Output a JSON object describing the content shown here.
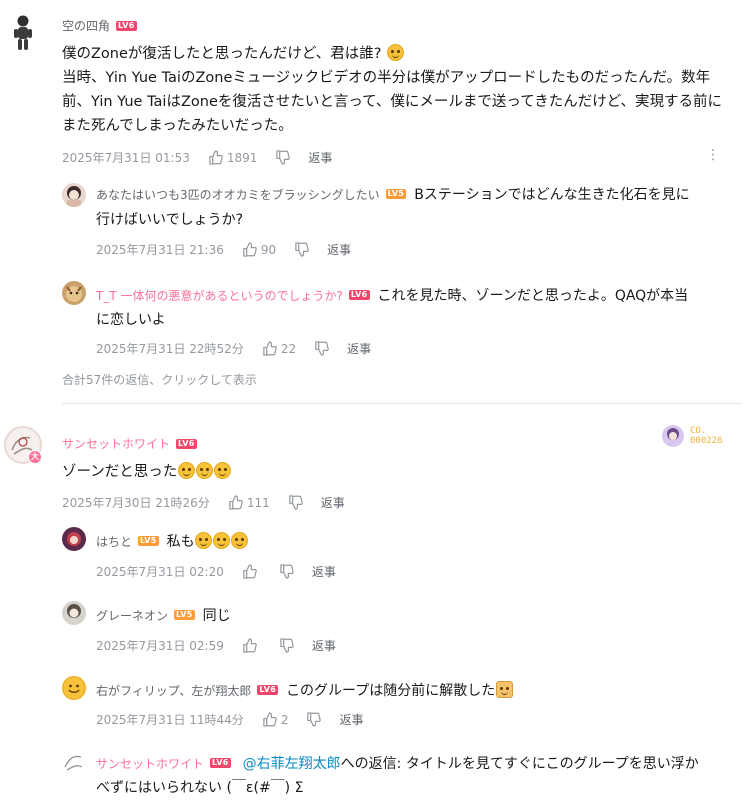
{
  "comments": [
    {
      "username": "空の四角",
      "level": "LV6",
      "text_lines": [
        "僕のZoneが復活したと思ったんだけど、君は誰?",
        "当時、Yin Yue TaiのZoneミュージックビデオの半分は僕がアップロードしたものだったんだ。数年",
        "前、Yin Yue TaiはZoneを復活させたいと言って、僕にメールまで送ってきたんだけど、実現する前に",
        "また死んでしまったみたいだった。"
      ],
      "time": "2025年7月31日 01:53",
      "likes": "1891",
      "reply_label": "返事",
      "replies": [
        {
          "username": "あなたはいつも3匹のオオカミをブラッシングしたい",
          "level": "LV5",
          "text_line1": "Bステーションではどんな生きた化石を見に",
          "text_line2": "行けばいいでしょうか?",
          "time": "2025年7月31日 21:36",
          "likes": "90",
          "reply_label": "返事"
        },
        {
          "username": "T_T 一体何の悪意があるというのでしょうか?",
          "level": "LV6",
          "text_line1": "これを見た時、ゾーンだと思ったよ。QAQが本当",
          "text_line2": "に恋しいよ",
          "time": "2025年7月31日 22時52分",
          "likes": "22",
          "reply_label": "返事"
        }
      ],
      "more_replies": "合計57件の返信、クリックして表示"
    },
    {
      "username": "サンセットホワイト",
      "level": "LV6",
      "badge_text": "CO.",
      "badge_number": "000226",
      "text": "ゾーンだと思った",
      "time": "2025年7月30日 21時26分",
      "likes": "111",
      "reply_label": "返事",
      "replies": [
        {
          "username": "はちと",
          "level": "LV5",
          "text": "私も",
          "time": "2025年7月31日 02:20",
          "reply_label": "返事"
        },
        {
          "username": "グレーネオン",
          "level": "LV5",
          "text": "同じ",
          "time": "2025年7月31日 02:59",
          "reply_label": "返事"
        },
        {
          "username": "右がフィリップ、左が翔太郎",
          "level": "LV6",
          "text": "このグループは随分前に解散した",
          "time": "2025年7月31日 11時44分",
          "likes": "2",
          "reply_label": "返事"
        },
        {
          "username": "サンセットホワイト",
          "level": "LV6",
          "mention": "@右菲左翔太郎",
          "reply_prefix": "への返信: ",
          "text_line1": "タイトルを見てすぐにこのグループを思い浮か",
          "text_line2": "べずにはいられない (￣ε(#￣) Σ"
        }
      ]
    }
  ]
}
